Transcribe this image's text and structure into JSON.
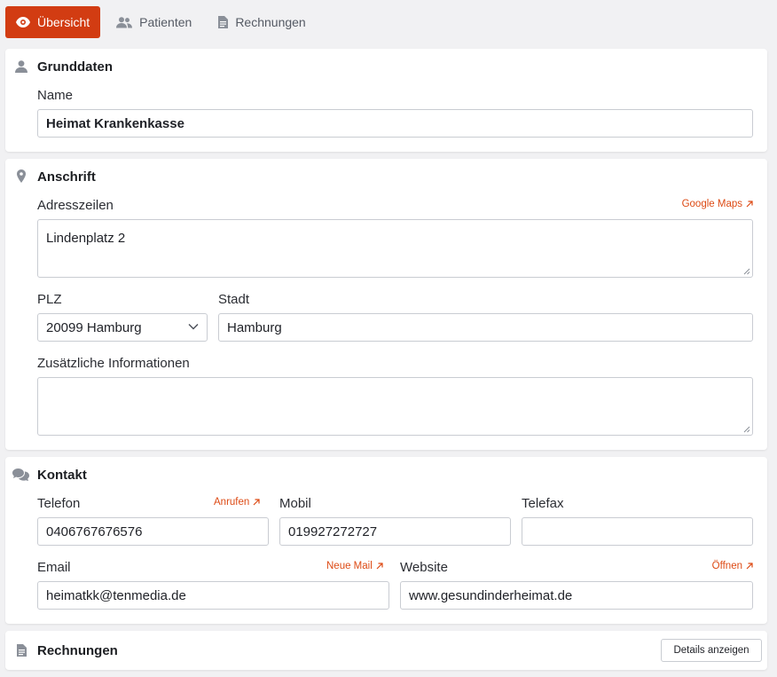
{
  "tabs": [
    {
      "label": "Übersicht",
      "icon": "eye-icon",
      "active": true
    },
    {
      "label": "Patienten",
      "icon": "users-icon",
      "active": false
    },
    {
      "label": "Rechnungen",
      "icon": "document-icon",
      "active": false
    }
  ],
  "grunddaten": {
    "title": "Grunddaten",
    "name_label": "Name",
    "name_value": "Heimat Krankenkasse"
  },
  "anschrift": {
    "title": "Anschrift",
    "address_label": "Adresszeilen",
    "maps_link": "Google Maps",
    "address_value": "Lindenplatz 2",
    "plz_label": "PLZ",
    "plz_value": "20099 Hamburg",
    "stadt_label": "Stadt",
    "stadt_value": "Hamburg",
    "info_label": "Zusätzliche Informationen",
    "info_value": ""
  },
  "kontakt": {
    "title": "Kontakt",
    "telefon_label": "Telefon",
    "telefon_link": "Anrufen",
    "telefon_value": "0406767676576",
    "mobil_label": "Mobil",
    "mobil_value": "019927272727",
    "telefax_label": "Telefax",
    "telefax_value": "",
    "email_label": "Email",
    "email_link": "Neue Mail",
    "email_value": "heimatkk@tenmedia.de",
    "website_label": "Website",
    "website_link": "Öffnen",
    "website_value": "www.gesundinderheimat.de"
  },
  "rechnungen": {
    "title": "Rechnungen",
    "details_button": "Details anzeigen"
  },
  "colors": {
    "accent": "#d23c12",
    "link": "#dd4a14",
    "background": "#f1f1f3"
  }
}
